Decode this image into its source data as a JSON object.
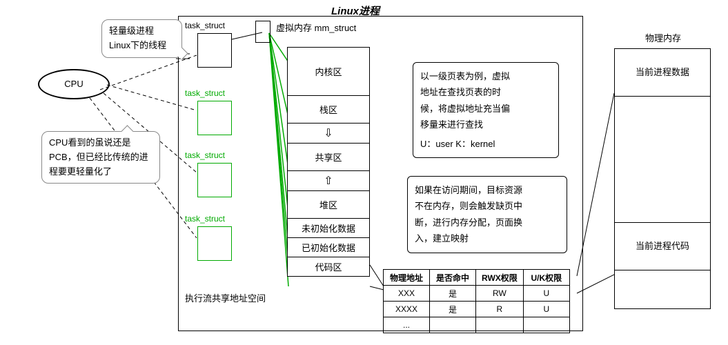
{
  "title": "Linux进程",
  "callout_lwp": {
    "line1": "轻量级进程",
    "line2": "Linux下的线程"
  },
  "cpu_label": "CPU",
  "callout_pcb": "CPU看到的虽说还是PCB，但已经比传统的进程要更轻量化了",
  "task_struct_label": "task_struct",
  "task_struct_green": "task_struct",
  "vm_title": "虚拟内存 mm_struct",
  "vm_sections": {
    "kernel": "内核区",
    "stack": "栈区",
    "shared": "共享区",
    "heap": "堆区",
    "bss": "未初始化数据",
    "data": "已初始化数据",
    "code": "代码区"
  },
  "exec_flow_label": "执行流共享地址空间",
  "note1": {
    "line1": "以一级页表为例，虚拟",
    "line2": "地址在查找页表的时",
    "line3": "候，将虚拟地址充当偏",
    "line4": "移量来进行查找",
    "line5": "U：user  K：kernel"
  },
  "note2": {
    "line1": "如果在访问期间，目标资源",
    "line2": "不在内存，则会触发缺页中",
    "line3": "断，进行内存分配，页面换",
    "line4": "入，建立映射"
  },
  "page_table": {
    "headers": {
      "addr": "物理地址",
      "hit": "是否命中",
      "rwx": "RWX权限",
      "uk": "U/K权限"
    },
    "rows": [
      {
        "addr": "XXX",
        "hit": "是",
        "rwx": "RW",
        "uk": "U"
      },
      {
        "addr": "XXXX",
        "hit": "是",
        "rwx": "R",
        "uk": "U"
      },
      {
        "addr": "...",
        "hit": "",
        "rwx": "",
        "uk": ""
      }
    ]
  },
  "physical": {
    "title": "物理内存",
    "data": "当前进程数据",
    "code": "当前进程代码"
  }
}
